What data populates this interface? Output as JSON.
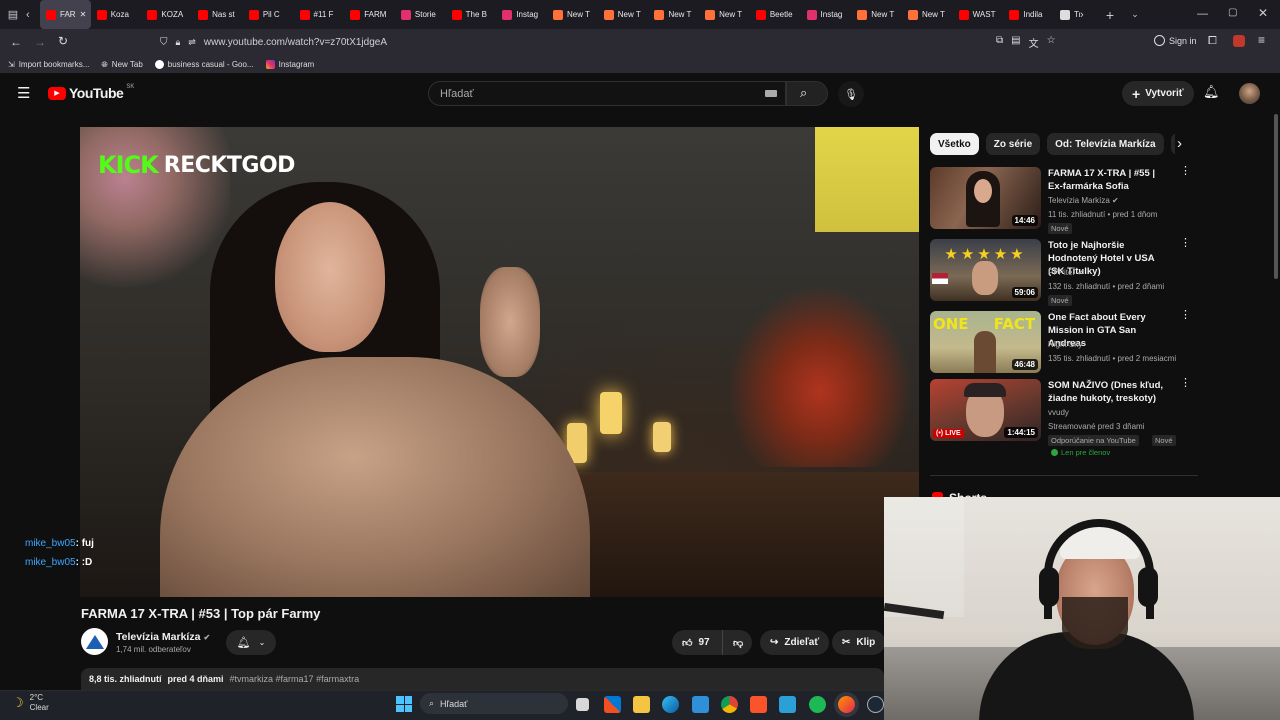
{
  "browser": {
    "tabs": [
      {
        "label": "FAR",
        "color": "#ff0000",
        "active": true
      },
      {
        "label": "Koza",
        "color": "#ff0000"
      },
      {
        "label": "KOZA",
        "color": "#ff0000"
      },
      {
        "label": "Nas st",
        "color": "#ff0000"
      },
      {
        "label": "Pil C",
        "color": "#ff0000"
      },
      {
        "label": "#11 F",
        "color": "#ff0000"
      },
      {
        "label": "FARM",
        "color": "#ff0000"
      },
      {
        "label": "Storie",
        "color": "#e1306c"
      },
      {
        "label": "The B",
        "color": "#ff0000"
      },
      {
        "label": "Instag",
        "color": "#e1306c"
      },
      {
        "label": "New T",
        "color": "#ff7139"
      },
      {
        "label": "New T",
        "color": "#ff7139"
      },
      {
        "label": "New T",
        "color": "#ff7139"
      },
      {
        "label": "New T",
        "color": "#ff7139"
      },
      {
        "label": "Beetle",
        "color": "#ff0000"
      },
      {
        "label": "Instag",
        "color": "#e1306c"
      },
      {
        "label": "New T",
        "color": "#ff7139"
      },
      {
        "label": "New T",
        "color": "#ff7139"
      },
      {
        "label": "WAST",
        "color": "#ff0000"
      },
      {
        "label": "Indila",
        "color": "#ff0000"
      },
      {
        "label": "Tr",
        "color": "#dddddd"
      }
    ],
    "url": "www.youtube.com/watch?v=z70tX1jdgeA",
    "sign_in": "Sign in",
    "bookmarks": [
      {
        "label": "Import bookmarks..."
      },
      {
        "label": "New Tab"
      },
      {
        "label": "business casual - Goo..."
      },
      {
        "label": "Instagram"
      }
    ]
  },
  "youtube": {
    "logo_text": "YouTube",
    "region": "SK",
    "search_placeholder": "Hľadať",
    "create_label": "Vytvoriť",
    "video": {
      "overlay_brand": "KICK",
      "overlay_name": "RECKTGOD",
      "title": "FARMA 17 X-TRA | #53 | Top pár Farmy",
      "channel": "Televízia Markíza",
      "subscribers": "1,74 mil. odberateľov",
      "likes": "97",
      "share_label": "Zdieľať",
      "clip_label": "Klip",
      "views": "8,8 tis. zhliadnutí",
      "age": "pred 4 dňami",
      "hashtags": "#tvmarkiza #farma17 #farmaxtra"
    },
    "chat": [
      {
        "user": "mike_bw05",
        "message": ": fuj"
      },
      {
        "user": "mike_bw05",
        "message": ": :D"
      }
    ],
    "chips": [
      "Všetko",
      "Zo série",
      "Od: Televízia Markíza",
      "Pr"
    ],
    "recommendations": [
      {
        "title": "FARMA 17 X-TRA | #55 | Ex-farmárka Sofia",
        "channel": "Televízia Markíza",
        "meta": "11 tis. zhliadnutí • pred 1 dňom",
        "badge": "Nové",
        "duration": "14:46"
      },
      {
        "title": "Toto je Najhoršie Hodnotený Hotel v USA (SK Titulky)",
        "channel": "PPPiter",
        "meta": "132 tis. zhliadnutí • pred 2 dňami",
        "badge": "Nové",
        "duration": "59:06"
      },
      {
        "title": "One Fact about Every Mission in GTA San Andreas",
        "channel": "Night Sky",
        "meta": "135 tis. zhliadnutí • pred 2 mesiacmi",
        "badge": "",
        "duration": "46:48",
        "thumb_text": "ONE FACT"
      },
      {
        "title": "SOM NAŽIVO (Dnes kľud, žiadne hukoty, treskoty)",
        "channel": "vvudy",
        "meta": "Streamované pred 3 dňami",
        "badge": "Odporúčanie na YouTube",
        "badge2": "Nové",
        "members": "Len pre členov",
        "duration": "1:44:15",
        "live_label": "LIVE"
      }
    ],
    "shorts_label": "Shorts"
  },
  "taskbar": {
    "weather_temp": "2°C",
    "weather_desc": "Clear",
    "search_placeholder": "Hľadať"
  }
}
